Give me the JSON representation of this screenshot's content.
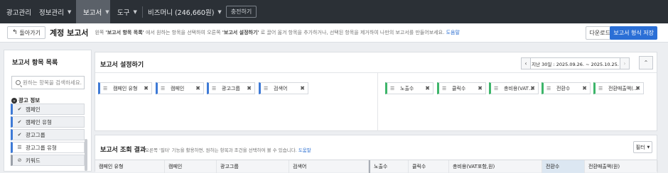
{
  "topnav": {
    "items": [
      {
        "label": "광고관리",
        "caret": false,
        "active": false
      },
      {
        "label": "정보관리",
        "caret": true,
        "active": false
      },
      {
        "label": "보고서",
        "caret": true,
        "active": true
      },
      {
        "label": "도구",
        "caret": true,
        "active": false
      },
      {
        "label": "비즈머니 (246,660원)",
        "caret": true,
        "active": false
      }
    ],
    "charge_label": "충전하기"
  },
  "header": {
    "back_label": "돌아가기",
    "title": "계정 보고서",
    "desc_prefix": "왼쪽 ",
    "desc_bold1": "'보고서 항목 목록'",
    "desc_mid": " 에서 원하는 항목을 선택하여 오른쪽 ",
    "desc_bold2": "'보고서 설정하기'",
    "desc_suffix": " 로 끌어 옮겨 항목을 추가하거나, 선택된 항목을 제거하여 나만의 보고서를 만들어보세요. ",
    "help_label": "도움말",
    "download_label": "다운로드",
    "save_label": "보고서 형식 저장"
  },
  "leftpanel": {
    "title": "보고서 항목 목록",
    "search_placeholder": "원하는 항목을 검색하세요.",
    "group_label": "광고 정보",
    "items": [
      {
        "label": "캠페인",
        "icon": "check"
      },
      {
        "label": "캠페인 유형",
        "icon": "check"
      },
      {
        "label": "광고그룹",
        "icon": "check"
      },
      {
        "label": "광고그룹 유형",
        "icon": "drag"
      },
      {
        "label": "키워드",
        "icon": "ban"
      }
    ]
  },
  "settings": {
    "title": "보고서 설정하기",
    "date_range": "지난 30일 : 2025.09.26. ~ 2025.10.25.",
    "dimension_chips": [
      "캠페인 유형",
      "캠페인",
      "광고그룹",
      "검색어"
    ],
    "metric_chips": [
      "노출수",
      "클릭수",
      "총비용(VAT…",
      "전환수",
      "전환매출액(…"
    ]
  },
  "results": {
    "title": "보고서 조회 결과",
    "desc": "오른쪽 '필터' 기능을 활용하면, 원하는 항목과 조건을 선택하여 볼 수 있습니다. ",
    "help_label": "도움말",
    "filter_label": "필터",
    "columns": [
      "캠페인 유형",
      "캠페인",
      "광고그룹",
      "검색어",
      "노출수",
      "클릭수",
      "총비용(VAT포함,원)",
      "전환수",
      "전환매출액(원)"
    ]
  }
}
